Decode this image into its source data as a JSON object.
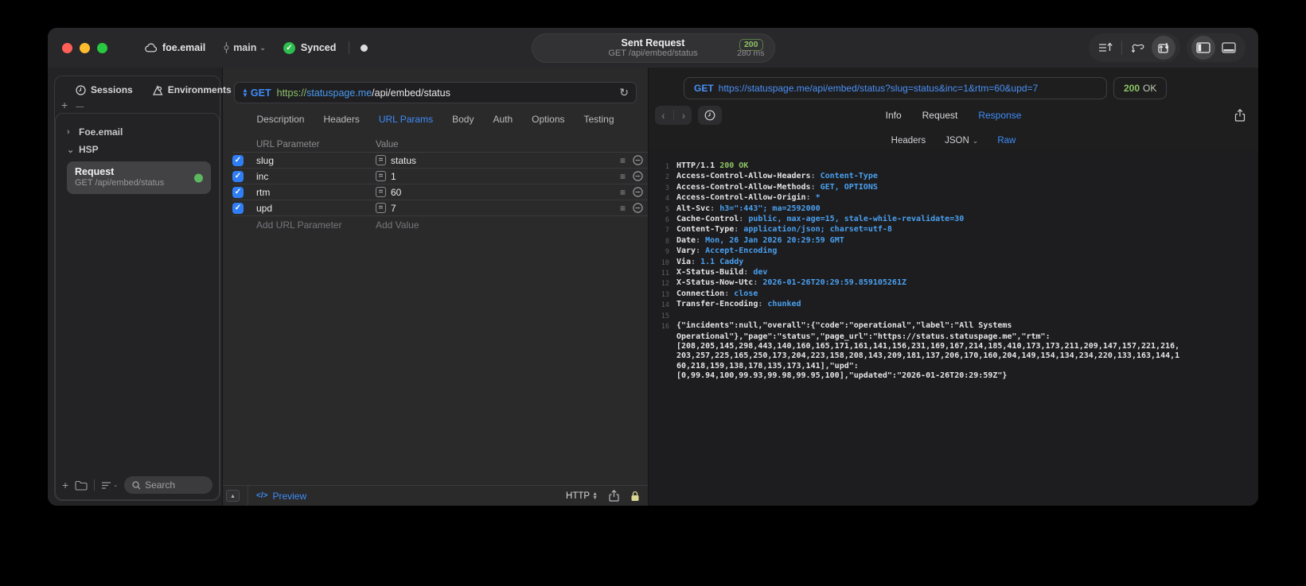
{
  "glyphs": {
    "check": "✓",
    "eq": "=",
    "reorder": "≡",
    "chevron_right": "›",
    "chevron_down": "⌄",
    "back": "‹",
    "forward": "›",
    "refresh": "↻",
    "up_triangle": "▴",
    "down_triangle": "▾",
    "plus": "+",
    "minus": "—",
    "code": "</>",
    "asterisk": "•"
  },
  "colors": {
    "accent_blue": "#3e8cf7",
    "code_value_blue": "#4aa0f0",
    "status_green": "#8dc463",
    "checkbox_blue": "#2f7ef5",
    "synced_green": "#2ebd4e",
    "request_dot_green": "#5cb85f"
  },
  "titlebar": {
    "workspace": "foe.email",
    "branch": "main",
    "sync_status": "Synced",
    "center": {
      "title": "Sent Request",
      "subtitle": "GET /api/embed/status",
      "status_code": "200",
      "duration": "280 ms"
    }
  },
  "sidebar": {
    "tabs": [
      {
        "label": "Sessions"
      },
      {
        "label": "Environments"
      }
    ],
    "tree": [
      {
        "label": "Foe.email",
        "state": "collapsed"
      },
      {
        "label": "HSP",
        "state": "expanded"
      }
    ],
    "request": {
      "title": "Request",
      "subtitle": "GET /api/embed/status"
    },
    "search_placeholder": "Search"
  },
  "request_pane": {
    "method": "GET",
    "url": {
      "scheme": "https://",
      "host": "statuspage.me",
      "path": "/api/embed/status"
    },
    "tabs": [
      "Description",
      "Headers",
      "URL Params",
      "Body",
      "Auth",
      "Options",
      "Testing"
    ],
    "active_tab": "URL Params",
    "table": {
      "columns": [
        "URL Parameter",
        "Value"
      ],
      "rows": [
        {
          "name": "slug",
          "value": "status",
          "checked": true
        },
        {
          "name": "inc",
          "value": "1",
          "checked": true
        },
        {
          "name": "rtm",
          "value": "60",
          "checked": true
        },
        {
          "name": "upd",
          "value": "7",
          "checked": true
        }
      ],
      "add_param": "Add URL Parameter",
      "add_value": "Add Value"
    },
    "footer": {
      "preview": "Preview",
      "protocol": "HTTP"
    }
  },
  "response_pane": {
    "method": "GET",
    "url": "https://statuspage.me/api/embed/status?slug=status&inc=1&rtm=60&upd=7",
    "status_code": "200",
    "status_text": "OK",
    "tabs": [
      "Info",
      "Request",
      "Response"
    ],
    "active_tab": "Response",
    "subtabs": [
      {
        "label": "Headers"
      },
      {
        "label": "JSON",
        "dropdown": true
      },
      {
        "label": "Raw"
      }
    ],
    "active_subtab": "Raw",
    "code": {
      "status_line": {
        "number": 1,
        "protocol": "HTTP/1.1 ",
        "status": "200 OK"
      },
      "headers": [
        {
          "number": 2,
          "name": "Access-Control-Allow-Headers",
          "value": "Content-Type"
        },
        {
          "number": 3,
          "name": "Access-Control-Allow-Methods",
          "value": "GET, OPTIONS"
        },
        {
          "number": 4,
          "name": "Access-Control-Allow-Origin",
          "value": "*"
        },
        {
          "number": 5,
          "name": "Alt-Svc",
          "value": "h3=\":443\"; ma=2592000"
        },
        {
          "number": 6,
          "name": "Cache-Control",
          "value": "public, max-age=15, stale-while-revalidate=30"
        },
        {
          "number": 7,
          "name": "Content-Type",
          "value": "application/json; charset=utf-8"
        },
        {
          "number": 8,
          "name": "Date",
          "value": "Mon, 26 Jan 2026 20:29:59 GMT"
        },
        {
          "number": 9,
          "name": "Vary",
          "value": "Accept-Encoding"
        },
        {
          "number": 10,
          "name": "Via",
          "value": "1.1 Caddy"
        },
        {
          "number": 11,
          "name": "X-Status-Build",
          "value": "dev"
        },
        {
          "number": 12,
          "name": "X-Status-Now-Utc",
          "value": "2026-01-26T20:29:59.859105261Z"
        },
        {
          "number": 13,
          "name": "Connection",
          "value": "close"
        },
        {
          "number": 14,
          "name": "Transfer-Encoding",
          "value": "chunked"
        }
      ],
      "blank_line_number": 15,
      "body": {
        "number": 16,
        "lines": [
          "{\"incidents\":null,\"overall\":{\"code\":\"operational\",\"label\":\"All Systems",
          "Operational\"},\"page\":\"status\",\"page_url\":\"https://status.statuspage.me\",\"rtm\":",
          "[208,205,145,298,443,140,160,165,171,161,141,156,231,169,167,214,185,410,173,173,211,209,147,157,221,216,",
          "203,257,225,165,250,173,204,223,158,208,143,209,181,137,206,170,160,204,149,154,134,234,220,133,163,144,1",
          "60,218,159,138,178,135,173,141],\"upd\":",
          "[0,99.94,100,99.93,99.98,99.95,100],\"updated\":\"2026-01-26T20:29:59Z\"}"
        ]
      }
    }
  }
}
